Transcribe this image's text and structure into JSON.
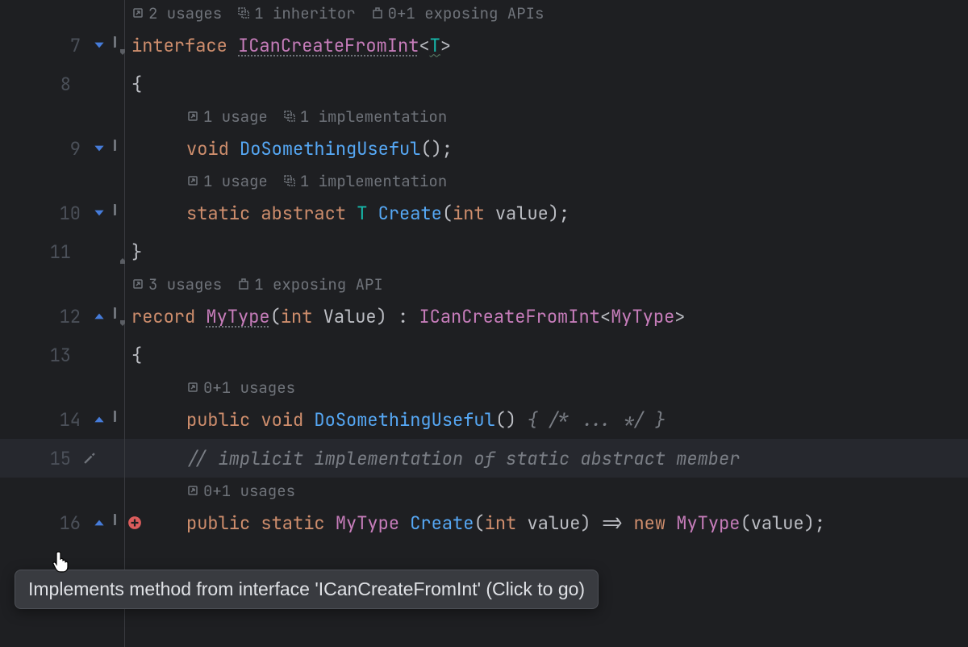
{
  "lines": {
    "lens_7": {
      "usages": "2 usages",
      "inheritor": "1 inheritor",
      "exposing": "0+1 exposing APIs"
    },
    "l7_num": "7",
    "l7_kw": "interface",
    "l7_type": "ICanCreateFromInt",
    "l7_generic": "T",
    "l8_num": "8",
    "l8_brace": "{",
    "lens_9": {
      "usages": "1 usage",
      "impl": "1 implementation"
    },
    "l9_num": "9",
    "l9_void": "void",
    "l9_method": "DoSomethingUseful",
    "lens_10": {
      "usages": "1 usage",
      "impl": "1 implementation"
    },
    "l10_num": "10",
    "l10_static": "static",
    "l10_abstract": "abstract",
    "l10_T": "T",
    "l10_method": "Create",
    "l10_ptype": "int",
    "l10_pname": "value",
    "l11_num": "11",
    "l11_brace": "}",
    "lens_12": {
      "usages": "3 usages",
      "exposing": "1 exposing API"
    },
    "l12_num": "12",
    "l12_record": "record",
    "l12_type": "MyType",
    "l12_ptype": "int",
    "l12_pname": "Value",
    "l12_iface": "ICanCreateFromInt",
    "l12_garg": "MyType",
    "l13_num": "13",
    "l13_brace": "{",
    "lens_14": {
      "usages": "0+1 usages"
    },
    "l14_num": "14",
    "l14_public": "public",
    "l14_void": "void",
    "l14_method": "DoSomethingUseful",
    "l14_body": "{ /* ... */ }",
    "l15_num": "15",
    "l15_comment": "// implicit implementation of static abstract member",
    "lens_16": {
      "usages": "0+1 usages"
    },
    "l16_num": "16",
    "l16_public": "public",
    "l16_static": "static",
    "l16_type": "MyType",
    "l16_method": "Create",
    "l16_ptype": "int",
    "l16_pname": "value",
    "l16_arrow": "=>",
    "l16_new": "new",
    "l16_ctor": "MyType",
    "l16_arg": "value"
  },
  "tooltip": "Implements method from interface 'ICanCreateFromInt' (Click to go)"
}
